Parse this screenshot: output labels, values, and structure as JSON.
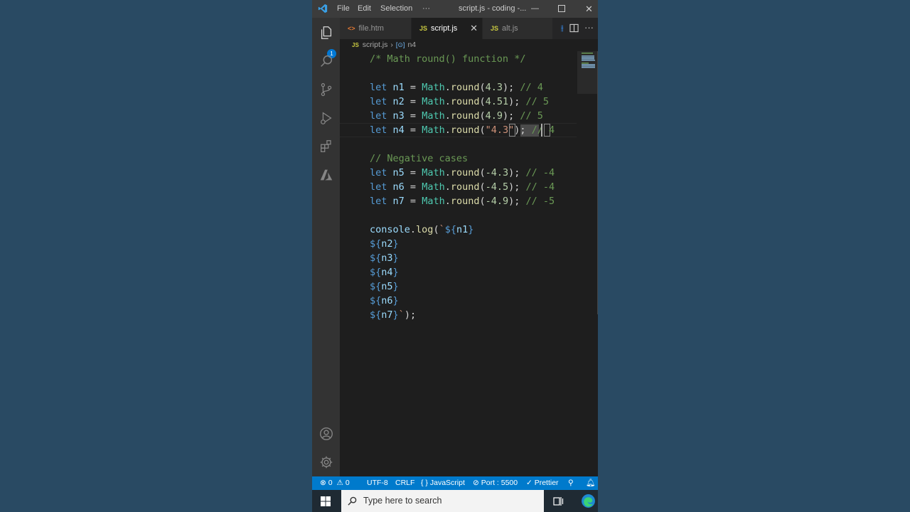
{
  "titlebar": {
    "menu": [
      "File",
      "Edit",
      "Selection",
      "···"
    ],
    "title": "script.js - coding -...",
    "minimize": "—",
    "close": "✕"
  },
  "activitybar": {
    "explorer_badge": "1",
    "icons": [
      "files-icon",
      "search-icon",
      "source-control-icon",
      "run-debug-icon",
      "extensions-icon",
      "azure-icon",
      "account-icon",
      "settings-gear-icon"
    ]
  },
  "tabs": [
    {
      "label": "file.htm",
      "icon": "<>",
      "active": false
    },
    {
      "label": "script.js",
      "icon": "JS",
      "active": true
    },
    {
      "label": "alt.js",
      "icon": "JS",
      "active": false
    }
  ],
  "breadcrumb": {
    "file_icon": "JS",
    "file": "script.js",
    "symbol_icon": "[⊙]",
    "symbol": "n4"
  },
  "code_lines": [
    "/* Math round() function */",
    "",
    "let n1 = Math.round(4.3); // 4",
    "let n2 = Math.round(4.51); // 5",
    "let n3 = Math.round(4.9); // 5",
    "let n4 = Math.round(\"4.3\"); // 4",
    "",
    "// Negative cases",
    "let n5 = Math.round(-4.3); // -4",
    "let n6 = Math.round(-4.5); // -4",
    "let n7 = Math.round(-4.9); // -5",
    "",
    "console.log(`${n1}",
    "${n2}",
    "${n3}",
    "${n4}",
    "${n5}",
    "${n6}",
    "${n7}`);"
  ],
  "statusbar": {
    "errors": "0",
    "warnings": "0",
    "encoding": "UTF-8",
    "eol": "CRLF",
    "language": "{ } JavaScript",
    "port": "Port : 5500",
    "prettier": "✓ Prettier"
  },
  "taskbar": {
    "search_placeholder": "Type here to search"
  }
}
